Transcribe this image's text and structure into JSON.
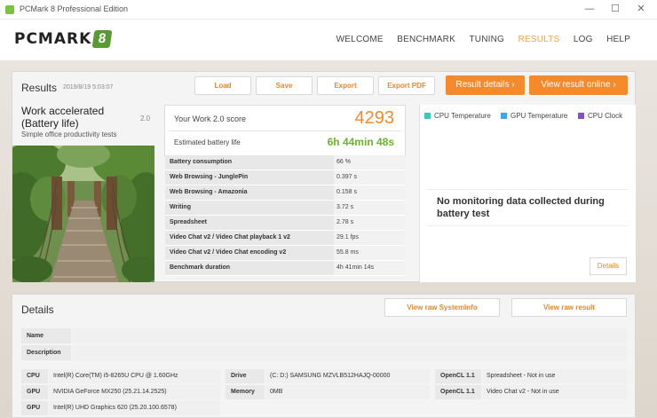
{
  "window": {
    "title": "PCMark 8 Professional Edition",
    "minimize": "—",
    "maximize": "☐",
    "close": "✕"
  },
  "header": {
    "logo_text": "PCMARK",
    "logo_badge": "8",
    "nav": [
      "WELCOME",
      "BENCHMARK",
      "TUNING",
      "RESULTS",
      "LOG",
      "HELP"
    ],
    "active_nav": "RESULTS"
  },
  "results": {
    "heading": "Results",
    "date": "2019/8/19 5:03:07",
    "buttons": {
      "load": "Load",
      "save": "Save",
      "export": "Export",
      "export_pdf": "Export PDF"
    },
    "result_details": "Result details",
    "view_online": "View result online",
    "test": {
      "title_line1": "Work accelerated",
      "title_line2": "(Battery life)",
      "version": "2.0",
      "subtitle": "Simple office productivity tests"
    },
    "score_label": "Your Work 2.0 score",
    "score_value": "4293",
    "battery_label": "Estimated battery life",
    "battery_value": "6h 44min 48s",
    "metrics": [
      {
        "name": "Battery consumption",
        "value": "66 %"
      },
      {
        "name": "Web Browsing - JunglePin",
        "value": "0.397 s"
      },
      {
        "name": "Web Browsing - Amazonia",
        "value": "0.158 s"
      },
      {
        "name": "Writing",
        "value": "3.72 s"
      },
      {
        "name": "Spreadsheet",
        "value": "2.78 s"
      },
      {
        "name": "Video Chat v2 / Video Chat playback 1 v2",
        "value": "29.1 fps"
      },
      {
        "name": "Video Chat v2 / Video Chat encoding v2",
        "value": "55.8 ms"
      },
      {
        "name": "Benchmark duration",
        "value": "4h 41min 14s"
      }
    ],
    "monitoring": {
      "legend": [
        {
          "label": "CPU Temperature",
          "color": "#3cc7b8"
        },
        {
          "label": "GPU Temperature",
          "color": "#3ea6e8"
        },
        {
          "label": "CPU Clock",
          "color": "#8a4fc4"
        }
      ],
      "message": "No monitoring data collected during battery test",
      "details_button": "Details"
    }
  },
  "details": {
    "heading": "Details",
    "view_systeminfo": "View raw SystemInfo",
    "view_result": "View raw result",
    "name_label": "Name",
    "description_label": "Description",
    "cpu": {
      "label": "CPU",
      "value": "Intel(R) Core(TM) i5-8265U CPU @ 1.60GHz"
    },
    "gpu1": {
      "label": "GPU",
      "value": "NVIDIA GeForce MX250 (25.21.14.2525)"
    },
    "gpu2": {
      "label": "GPU",
      "value": "Intel(R) UHD Graphics 620 (25.20.100.6578)"
    },
    "drive": {
      "label": "Drive",
      "value": "(C: D:) SAMSUNG MZVLB512HAJQ-00000"
    },
    "memory": {
      "label": "Memory",
      "value": "0MB"
    },
    "opencl1": {
      "label": "OpenCL 1.1",
      "value": "Spreadsheet - Not in use"
    },
    "opencl2": {
      "label": "OpenCL 1.1",
      "value": "Video Chat v2 - Not in use"
    }
  },
  "colors": {
    "accent": "#f58a2d",
    "score": "#f28c2b",
    "battery": "#6ab42d"
  }
}
